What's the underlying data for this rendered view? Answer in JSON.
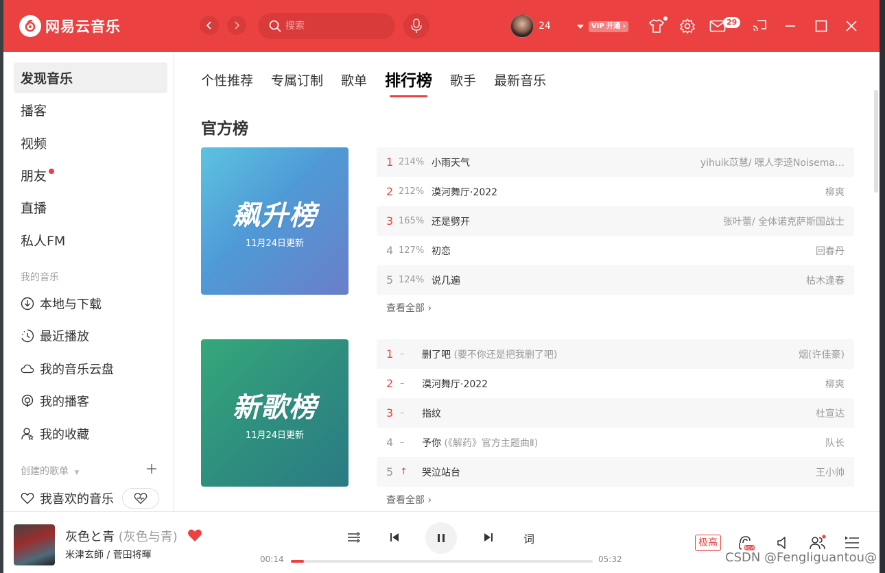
{
  "app": {
    "name": "网易云音乐",
    "search_placeholder": "搜索",
    "username": "24",
    "vip_label": "VIP 开通 ›",
    "mail_count": "29",
    "accent": "#ec4141"
  },
  "sidebar": {
    "main_items": [
      {
        "label": "发现音乐",
        "active": true
      },
      {
        "label": "播客"
      },
      {
        "label": "视频"
      },
      {
        "label": "朋友",
        "dot": true
      },
      {
        "label": "直播"
      },
      {
        "label": "私人FM"
      }
    ],
    "my_music_header": "我的音乐",
    "my_music_items": [
      {
        "label": "本地与下载",
        "icon": "download-icon"
      },
      {
        "label": "最近播放",
        "icon": "history-icon"
      },
      {
        "label": "我的音乐云盘",
        "icon": "cloud-icon"
      },
      {
        "label": "我的播客",
        "icon": "podcast-icon"
      },
      {
        "label": "我的收藏",
        "icon": "collection-icon"
      }
    ],
    "created_header": "创建的歌单",
    "liked_playlist": "我喜欢的音乐"
  },
  "tabs": [
    {
      "label": "个性推荐"
    },
    {
      "label": "专属订制"
    },
    {
      "label": "歌单"
    },
    {
      "label": "排行榜",
      "active": true
    },
    {
      "label": "歌手"
    },
    {
      "label": "最新音乐"
    }
  ],
  "section_title": "官方榜",
  "charts": [
    {
      "cover_title": "飙升榜",
      "cover_date": "11月24日更新",
      "view_all": "查看全部 ›",
      "rows": [
        {
          "rank": "1",
          "pct": "214%",
          "song": "小雨天气",
          "alias": "",
          "artist": "yihuik苡慧/ 嘿人李逵Noisema…"
        },
        {
          "rank": "2",
          "pct": "212%",
          "song": "漠河舞厅·2022",
          "alias": "",
          "artist": "柳爽"
        },
        {
          "rank": "3",
          "pct": "165%",
          "song": "还是劈开",
          "alias": "",
          "artist": "张叶蕾/ 全体诺克萨斯国战士"
        },
        {
          "rank": "4",
          "pct": "127%",
          "song": "初恋",
          "alias": "",
          "artist": "回春丹"
        },
        {
          "rank": "5",
          "pct": "124%",
          "song": "说几遍",
          "alias": "",
          "artist": "枯木逢春"
        }
      ]
    },
    {
      "cover_title": "新歌榜",
      "cover_date": "11月24日更新",
      "view_all": "查看全部 ›",
      "rows": [
        {
          "rank": "1",
          "trend": "–",
          "song": "删了吧",
          "alias": " (要不你还是把我删了吧)",
          "artist": "烟(许佳豪)"
        },
        {
          "rank": "2",
          "trend": "–",
          "song": "漠河舞厅·2022",
          "alias": "",
          "artist": "柳爽"
        },
        {
          "rank": "3",
          "trend": "–",
          "song": "指纹",
          "alias": "",
          "artist": "杜宣达"
        },
        {
          "rank": "4",
          "trend": "–",
          "song": "予你",
          "alias": " (《解药》官方主题曲Ⅱ)",
          "artist": "队长"
        },
        {
          "rank": "5",
          "trend": "↑",
          "song": "哭泣站台",
          "alias": "",
          "artist": "王小帅"
        }
      ]
    }
  ],
  "player": {
    "title": "灰色と青",
    "alias": " (灰色与青)",
    "artist": "米津玄師 / 菅田将暉",
    "current_time": "00:14",
    "total_time": "05:32",
    "progress": 0.044,
    "lyric_label": "词",
    "quality": "极高"
  },
  "watermark": "CSDN @Fengliguantou@"
}
